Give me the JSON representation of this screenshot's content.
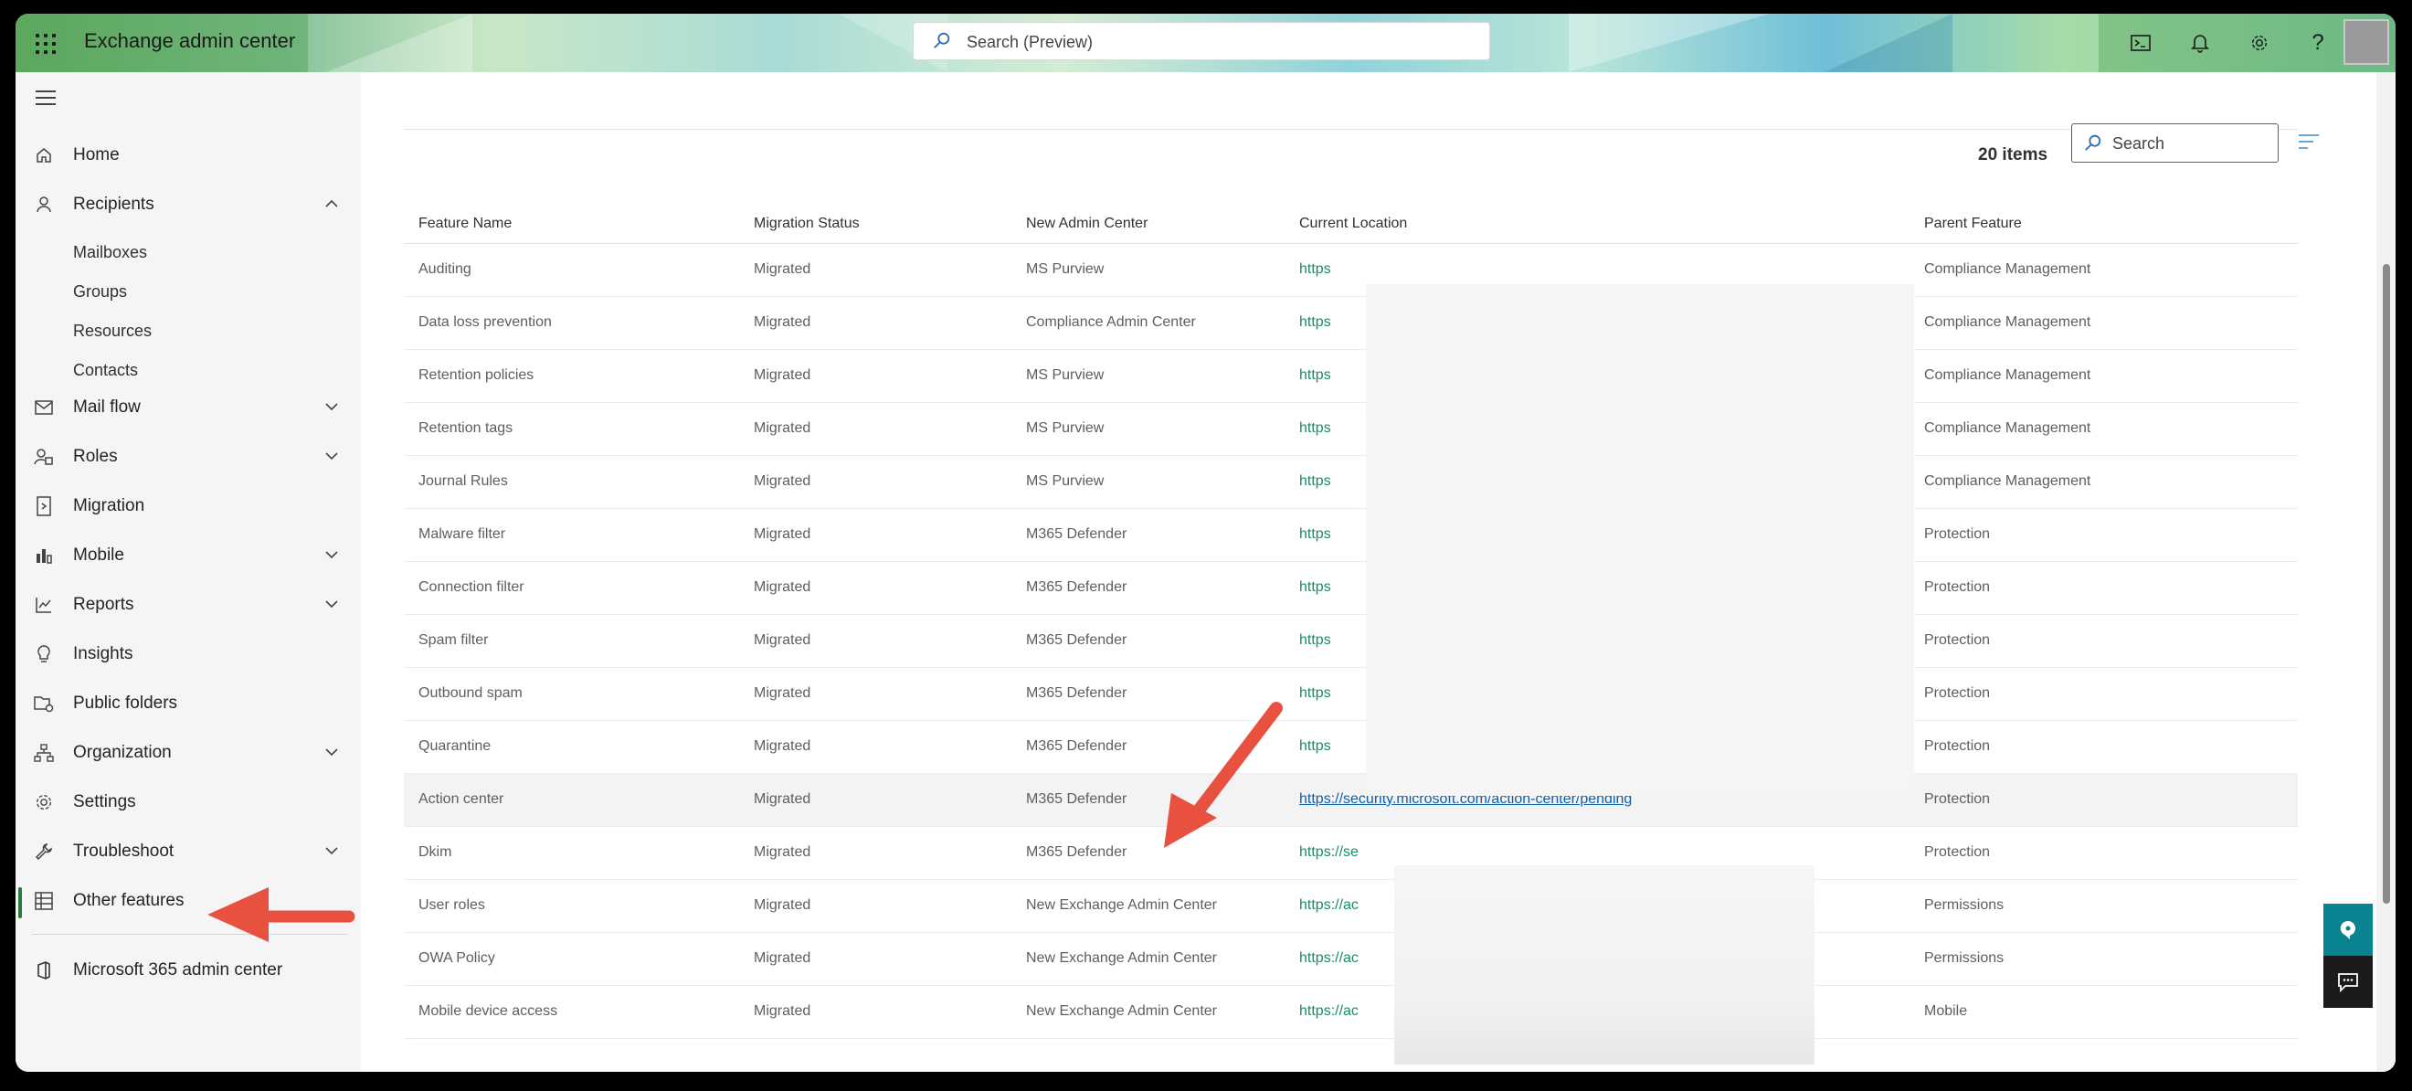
{
  "app": {
    "title": "Exchange admin center"
  },
  "top_search": {
    "placeholder": "Search (Preview)"
  },
  "top_icons": [
    "terminal-icon",
    "bell-icon",
    "gear-icon",
    "help-icon"
  ],
  "sidebar": {
    "items": [
      {
        "label": "Home",
        "icon": "home-icon"
      },
      {
        "label": "Recipients",
        "icon": "person-icon",
        "expanded": true,
        "children": [
          "Mailboxes",
          "Groups",
          "Resources",
          "Contacts"
        ]
      },
      {
        "label": "Mail flow",
        "icon": "mail-icon"
      },
      {
        "label": "Roles",
        "icon": "roles-icon"
      },
      {
        "label": "Migration",
        "icon": "migration-icon"
      },
      {
        "label": "Mobile",
        "icon": "mobile-icon"
      },
      {
        "label": "Reports",
        "icon": "reports-icon"
      },
      {
        "label": "Insights",
        "icon": "lightbulb-icon"
      },
      {
        "label": "Public folders",
        "icon": "folder-icon"
      },
      {
        "label": "Organization",
        "icon": "org-icon"
      },
      {
        "label": "Settings",
        "icon": "gear-icon"
      },
      {
        "label": "Troubleshoot",
        "icon": "wrench-icon"
      },
      {
        "label": "Other features",
        "icon": "table-icon",
        "active": true
      }
    ],
    "footer": {
      "label": "Microsoft 365 admin center",
      "icon": "office-icon"
    }
  },
  "table": {
    "count": "20 items",
    "search_placeholder": "Search",
    "columns": [
      "Feature Name",
      "Migration Status",
      "New Admin Center",
      "Current Location",
      "Parent Feature"
    ],
    "rows": [
      [
        "Auditing",
        "Migrated",
        "MS Purview",
        "https",
        "Compliance Management"
      ],
      [
        "Data loss prevention",
        "Migrated",
        "Compliance Admin Center",
        "https",
        "Compliance Management"
      ],
      [
        "Retention policies",
        "Migrated",
        "MS Purview",
        "https",
        "Compliance Management"
      ],
      [
        "Retention tags",
        "Migrated",
        "MS Purview",
        "https",
        "Compliance Management"
      ],
      [
        "Journal Rules",
        "Migrated",
        "MS Purview",
        "https",
        "Compliance Management"
      ],
      [
        "Malware filter",
        "Migrated",
        "M365 Defender",
        "https",
        "Protection"
      ],
      [
        "Connection filter",
        "Migrated",
        "M365 Defender",
        "https",
        "Protection"
      ],
      [
        "Spam filter",
        "Migrated",
        "M365 Defender",
        "https",
        "Protection"
      ],
      [
        "Outbound spam",
        "Migrated",
        "M365 Defender",
        "https",
        "Protection"
      ],
      [
        "Quarantine",
        "Migrated",
        "M365 Defender",
        "https",
        "Protection"
      ],
      [
        "Action center",
        "Migrated",
        "M365 Defender",
        "https://security.microsoft.com/action-center/pending",
        "Protection"
      ],
      [
        "Dkim",
        "Migrated",
        "M365 Defender",
        "https://se",
        "Protection"
      ],
      [
        "User roles",
        "Migrated",
        "New Exchange Admin Center",
        "https://ac",
        "Permissions"
      ],
      [
        "OWA Policy",
        "Migrated",
        "New Exchange Admin Center",
        "https://ac",
        "Permissions"
      ],
      [
        "Mobile device access",
        "Migrated",
        "New Exchange Admin Center",
        "https://ac",
        "Mobile"
      ]
    ],
    "selected_row": 10
  },
  "colors": {
    "accent": "#2c7a3e",
    "link": "#1a8a6b",
    "arrow": "#e8503f",
    "teal": "#08838f"
  }
}
